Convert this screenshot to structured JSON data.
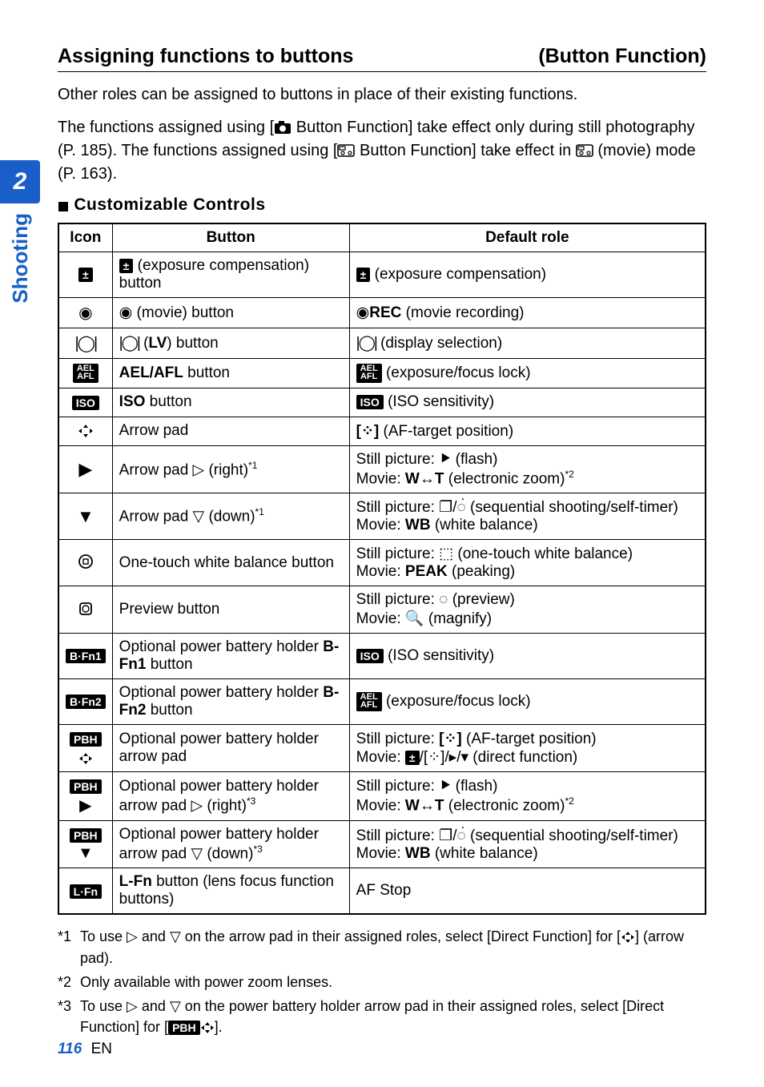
{
  "heading": {
    "left": "Assigning functions to buttons",
    "right": "(Button Function)"
  },
  "intro1": "Other roles can be assigned to buttons in place of their existing functions.",
  "intro2_a": "The functions assigned using [",
  "intro2_b": " Button Function] take effect only during still photography (P. 185). The functions assigned using [",
  "intro2_c": " Button Function] take effect in ",
  "intro2_d": " (movie) mode (P. 163).",
  "sub_heading": "Customizable Controls",
  "table": {
    "headers": {
      "icon": "Icon",
      "button": "Button",
      "default": "Default role"
    },
    "rows": [
      {
        "button_html": "<span class='boxed'>±</span> (exposure compensation) button",
        "role_html": "<span class='boxed'>±</span> (exposure compensation)"
      },
      {
        "button_html": "<span class='glyph'>◉</span> (movie) button",
        "role_html": "<span class='glyph'>◉</span><span class='bold'>REC</span> (movie recording)"
      },
      {
        "button_html": "<span class='glyph' style='letter-spacing:-2px;'>|◯|</span> (<span class='bold'>LV</span>) button",
        "role_html": "<span class='glyph' style='letter-spacing:-2px;'>|◯|</span> (display selection)"
      },
      {
        "button_html": "<span class='bold'>AEL/AFL</span> button",
        "role_html": "<span class='boxed'><span class='smallstack'>AEL<br>AFL</span></span> (exposure/focus lock)"
      },
      {
        "button_html": "<span class='bold'>ISO</span> button",
        "role_html": "<span class='boxed'>ISO</span> (ISO sensitivity)"
      },
      {
        "button_html": "Arrow pad",
        "role_html": "<span class='bold'>[⁘]</span> (AF-target position)"
      },
      {
        "button_html": "Arrow pad <span class='glyph'>▷</span> (right)<span class='sup'>*1</span>",
        "role_html": "Still picture: <span class='glyph bold'>⯈</span> (flash)<br>Movie: <span class='bold'>W↔T</span> (electronic zoom)<span class='sup'>*2</span>"
      },
      {
        "button_html": "Arrow pad <span class='glyph'>▽</span> (down)<span class='sup'>*1</span>",
        "role_html": "Still picture: <span class='glyph'>❐</span>/<span class='glyph'>◌̇</span> (sequential shooting/self-timer)<br>Movie: <span class='bold'>WB</span> (white balance)"
      },
      {
        "button_html": "One-touch white balance button",
        "role_html": "Still picture: <span class='glyph'>⬚</span> (one-touch white balance)<br>Movie: <span class='bold'>PEAK</span> (peaking)"
      },
      {
        "button_html": "Preview button",
        "role_html": "Still picture: <span class='glyph'>◌</span> (preview)<br>Movie: <span class='glyph bold'>🔍</span> (magnify)"
      },
      {
        "button_html": "Optional power battery holder <span class='bold'>B-Fn1</span> button",
        "role_html": "<span class='boxed'>ISO</span> (ISO sensitivity)"
      },
      {
        "button_html": "Optional power battery holder <span class='bold'>B-Fn2</span> button",
        "role_html": "<span class='boxed'><span class='smallstack'>AEL<br>AFL</span></span> (exposure/focus lock)"
      },
      {
        "button_html": "Optional power battery holder arrow pad",
        "role_html": "Still picture: <span class='bold'>[⁘]</span> (AF-target position)<br>Movie: <span class='boxed'>±</span>/[⁘]/<span class='glyph'>▸</span>/<span class='glyph'>▾</span> (direct function)"
      },
      {
        "button_html": "Optional power battery holder arrow pad <span class='glyph'>▷</span> (right)<span class='sup'>*3</span>",
        "role_html": "Still picture: <span class='glyph bold'>⯈</span> (flash)<br>Movie: <span class='bold'>W↔T</span> (electronic zoom)<span class='sup'>*2</span>"
      },
      {
        "button_html": "Optional power battery holder arrow pad <span class='glyph'>▽</span> (down)<span class='sup'>*3</span>",
        "role_html": "Still picture: <span class='glyph'>❐</span>/<span class='glyph'>◌̇</span> (sequential shooting/self-timer)<br>Movie: <span class='bold'>WB</span> (white balance)"
      },
      {
        "button_html": "<span class='bold'>L-Fn</span> button (lens focus function buttons)",
        "role_html": "AF Stop"
      }
    ]
  },
  "notes": {
    "n1_a": "To use ",
    "n1_b": " and ",
    "n1_c": " on the arrow pad in their assigned roles, select [Direct Function] for [",
    "n1_d": "] (arrow pad).",
    "n2": "Only available with power zoom lenses.",
    "n3_a": "To use ",
    "n3_b": " and ",
    "n3_c": " on the power battery holder arrow pad in their assigned roles, select [Direct Function] for [",
    "n3_d": "]."
  },
  "sidebar": {
    "chapter": "2",
    "label": "Shooting"
  },
  "footer": {
    "page": "116",
    "lang": "EN"
  }
}
